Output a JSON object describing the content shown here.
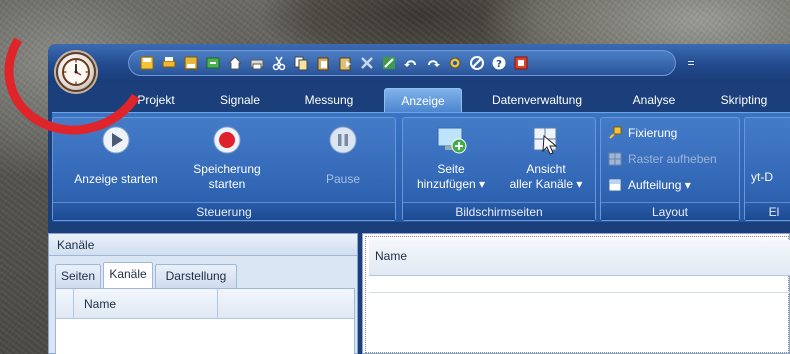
{
  "quick_access": {
    "icons": [
      "save-icon",
      "print-icon",
      "save-as-icon",
      "export-icon",
      "home-icon",
      "printer-icon",
      "cut-icon",
      "copy-icon",
      "paste-icon",
      "paste-special-icon",
      "delete-icon",
      "wizard-icon",
      "undo-icon",
      "redo-icon",
      "gear-icon",
      "stop-icon",
      "help-icon",
      "pdf-icon"
    ],
    "more": "="
  },
  "tabs": [
    {
      "label": "Projekt"
    },
    {
      "label": "Signale"
    },
    {
      "label": "Messung"
    },
    {
      "label": "Anzeige"
    },
    {
      "label": "Datenverwaltung"
    },
    {
      "label": "Analyse"
    },
    {
      "label": "Skripting"
    }
  ],
  "ribbon": {
    "steuerung": {
      "title": "Steuerung",
      "anzeige_starten": "Anzeige starten",
      "speicherung_l1": "Speicherung",
      "speicherung_l2": "starten",
      "pause": "Pause"
    },
    "bildschirmseiten": {
      "title": "Bildschirmseiten",
      "seite_l1": "Seite",
      "seite_l2": "hinzufügen ▾",
      "ansicht_l1": "Ansicht",
      "ansicht_l2": "aller Kanäle ▾"
    },
    "layout": {
      "title": "Layout",
      "fixierung": "Fixierung",
      "raster": "Raster aufheben",
      "aufteilung": "Aufteilung ▾"
    },
    "next_group": {
      "title": "El",
      "label": "yt-D"
    }
  },
  "left_panel": {
    "header": "Kanäle",
    "tabs": [
      "Seiten",
      "Kanäle",
      "Darstellung"
    ],
    "active_tab": "Kanäle",
    "column_name": "Name"
  },
  "right_panel": {
    "column_name": "Name"
  },
  "colors": {
    "accent": "#2c62b2",
    "annotation_ring": "#e0252a",
    "record": "#e0202a"
  }
}
